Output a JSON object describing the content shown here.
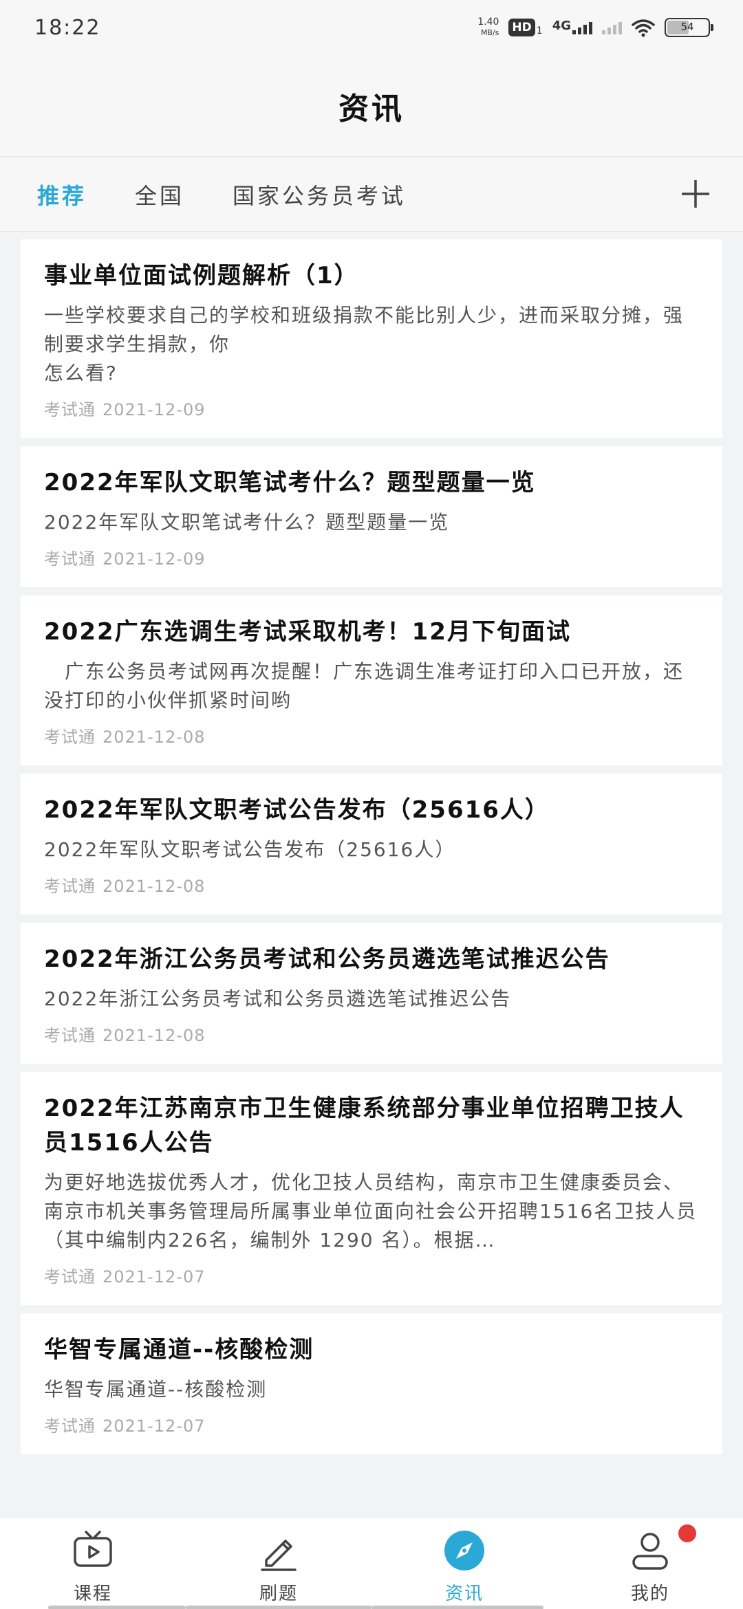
{
  "status_bar": {
    "time": "18:22",
    "net_speed_value": "1.40",
    "net_speed_unit": "MB/s",
    "hd_label": "HD",
    "hd_sub": "1",
    "network_type": "4G",
    "battery_level": "54"
  },
  "header": {
    "title": "资讯"
  },
  "tabs": [
    {
      "label": "推荐",
      "active": true
    },
    {
      "label": "全国",
      "active": false
    },
    {
      "label": "国家公务员考试",
      "active": false
    }
  ],
  "articles": [
    {
      "title": "事业单位面试例题解析（1）",
      "summary": "一些学校要求自己的学校和班级捐款不能比别人少，进而采取分摊，强制要求学生捐款，你\n怎么看?",
      "source": "考试通",
      "date": "2021-12-09"
    },
    {
      "title": "2022年军队文职笔试考什么？题型题量一览",
      "summary": "2022年军队文职笔试考什么？题型题量一览",
      "source": "考试通",
      "date": "2021-12-09"
    },
    {
      "title": "2022广东选调生考试采取机考！12月下旬面试",
      "summary": "　广东公务员考试网再次提醒！广东选调生准考证打印入口已开放，还没打印的小伙伴抓紧时间哟",
      "source": "考试通",
      "date": "2021-12-08"
    },
    {
      "title": "2022年军队文职考试公告发布（25616人）",
      "summary": "2022年军队文职考试公告发布（25616人）",
      "source": "考试通",
      "date": "2021-12-08"
    },
    {
      "title": "2022年浙江公务员考试和公务员遴选笔试推迟公告",
      "summary": "2022年浙江公务员考试和公务员遴选笔试推迟公告",
      "source": "考试通",
      "date": "2021-12-08"
    },
    {
      "title": "2022年江苏南京市卫生健康系统部分事业单位招聘卫技人员1516人公告",
      "summary": "为更好地选拔优秀人才，优化卫技人员结构，南京市卫生健康委员会、南京市机关事务管理局所属事业单位面向社会公开招聘1516名卫技人员（其中编制内226名，编制外 1290 名）。根据…",
      "source": "考试通",
      "date": "2021-12-07"
    },
    {
      "title": "华智专属通道--核酸检测",
      "summary": "华智专属通道--核酸检测",
      "source": "考试通",
      "date": "2021-12-07"
    }
  ],
  "bottom_nav": [
    {
      "label": "课程",
      "icon": "tv-play-icon",
      "active": false
    },
    {
      "label": "刷题",
      "icon": "pencil-icon",
      "active": false
    },
    {
      "label": "资讯",
      "icon": "compass-icon",
      "active": true
    },
    {
      "label": "我的",
      "icon": "user-icon",
      "active": false
    }
  ],
  "colors": {
    "accent": "#2aa8d6",
    "badge": "#e53935"
  }
}
